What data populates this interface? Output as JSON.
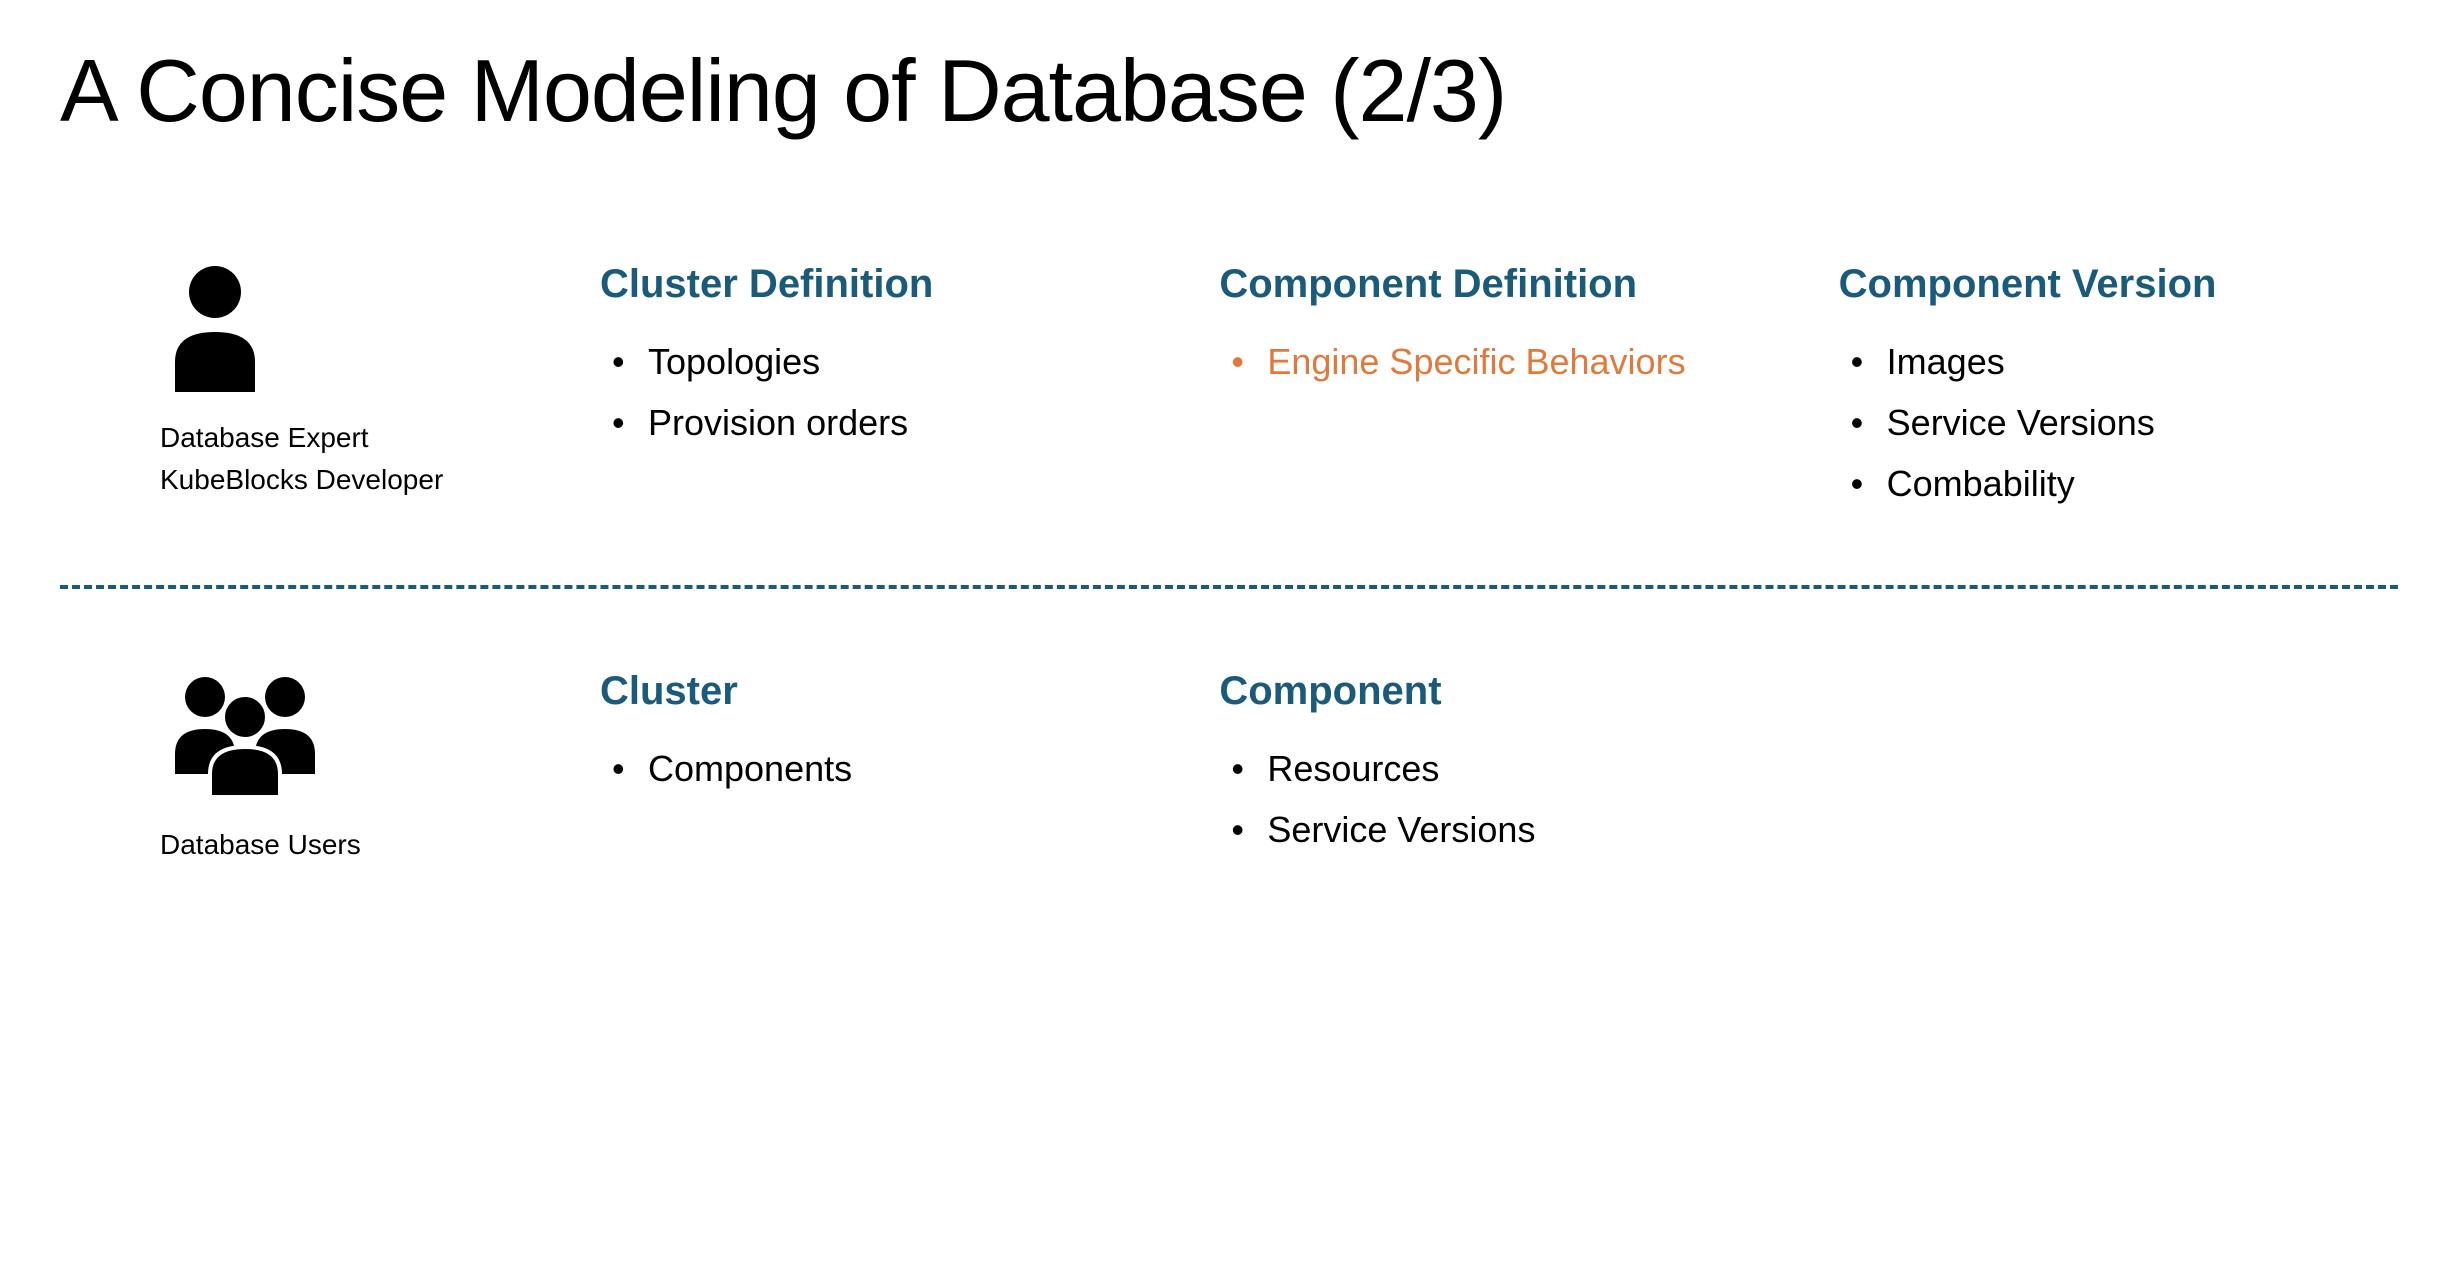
{
  "title": "A Concise Modeling of Database (2/3)",
  "top_row": {
    "persona": {
      "label1": "Database Expert",
      "label2": "KubeBlocks Developer"
    },
    "cols": [
      {
        "heading": "Cluster Definition",
        "items": [
          {
            "text": "Topologies",
            "highlight": false
          },
          {
            "text": "Provision orders",
            "highlight": false
          }
        ]
      },
      {
        "heading": "Component Definition",
        "items": [
          {
            "text": "Engine Specific Behaviors",
            "highlight": true
          }
        ]
      },
      {
        "heading": "Component Version",
        "items": [
          {
            "text": "Images",
            "highlight": false
          },
          {
            "text": "Service Versions",
            "highlight": false
          },
          {
            "text": "Combability",
            "highlight": false
          }
        ]
      }
    ]
  },
  "bottom_row": {
    "persona": {
      "label1": "Database Users"
    },
    "cols": [
      {
        "heading": "Cluster",
        "items": [
          {
            "text": "Components",
            "highlight": false
          }
        ]
      },
      {
        "heading": "Component",
        "items": [
          {
            "text": "Resources",
            "highlight": false
          },
          {
            "text": "Service Versions",
            "highlight": false
          }
        ]
      }
    ]
  }
}
